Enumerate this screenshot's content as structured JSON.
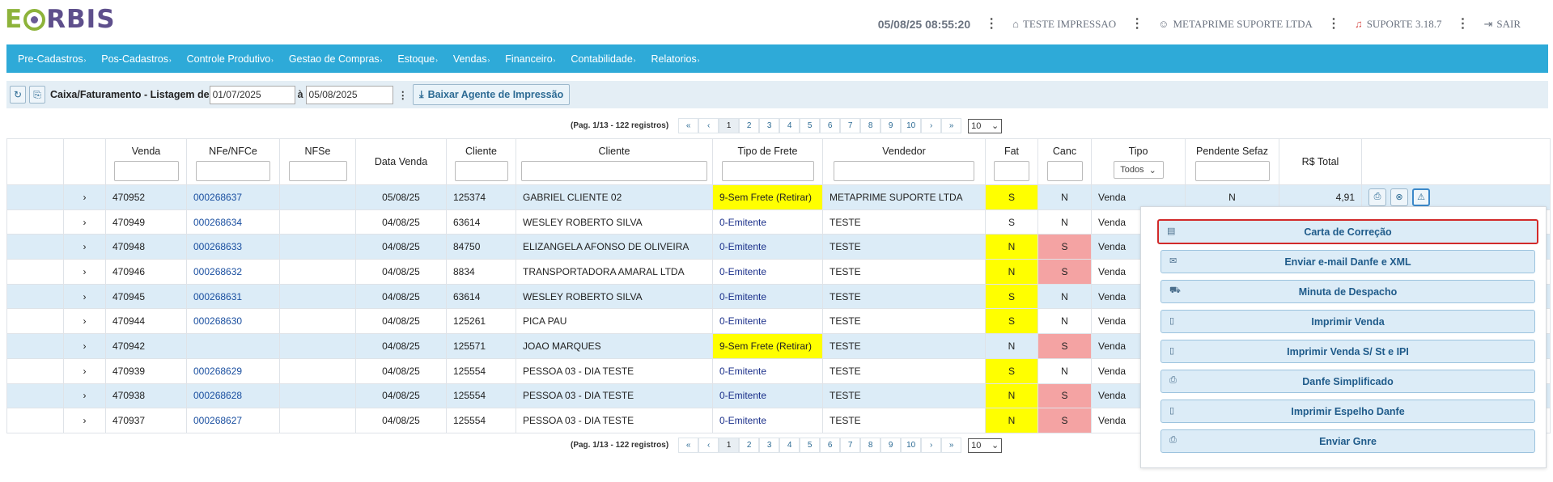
{
  "brand": {
    "logo_e": "E",
    "logo_rest": "RBIS"
  },
  "header": {
    "datetime": "05/08/25 08:55:20",
    "printer_label": "TESTE IMPRESSAO",
    "company_label": "METAPRIME SUPORTE LTDA",
    "support_label": "SUPORTE 3.18.7",
    "logout_label": "SAIR"
  },
  "menu": [
    {
      "label": "Pre-Cadastros"
    },
    {
      "label": "Pos-Cadastros"
    },
    {
      "label": "Controle Produtivo"
    },
    {
      "label": "Gestao de Compras"
    },
    {
      "label": "Estoque"
    },
    {
      "label": "Vendas"
    },
    {
      "label": "Financeiro"
    },
    {
      "label": "Contabilidade"
    },
    {
      "label": "Relatorios"
    }
  ],
  "toolbar": {
    "title": "Caixa/Faturamento - Listagem de",
    "date_from": "01/07/2025",
    "date_sep": "à",
    "date_to": "05/08/2025",
    "download_label": "Baixar Agente de Impressão"
  },
  "pager": {
    "info": "(Pag. 1/13 - 122 registros)",
    "first": "«",
    "prev": "‹",
    "pages": [
      "1",
      "2",
      "3",
      "4",
      "5",
      "6",
      "7",
      "8",
      "9",
      "10"
    ],
    "next": "›",
    "last": "»",
    "page_size": "10"
  },
  "columns": [
    "",
    "",
    "Venda",
    "NFe/NFCe",
    "NFSe",
    "Data Venda",
    "Cliente",
    "Cliente",
    "Tipo de Frete",
    "Vendedor",
    "Fat",
    "Canc",
    "Tipo",
    "Pendente Sefaz",
    "R$ Total",
    ""
  ],
  "tipo_filter": "Todos",
  "rows": [
    {
      "expand": "›",
      "venda": "470952",
      "nfe": "000268637",
      "nfse": "",
      "data": "05/08/25",
      "cliente_id": "125374",
      "cliente": "GABRIEL CLIENTE 02",
      "frete": "9-Sem Frete (Retirar)",
      "vendedor": "METAPRIME SUPORTE LTDA",
      "fat": "S",
      "canc": "N",
      "tipo": "Venda",
      "pendente": "N",
      "total": "4,91"
    },
    {
      "expand": "›",
      "venda": "470949",
      "nfe": "000268634",
      "nfse": "",
      "data": "04/08/25",
      "cliente_id": "63614",
      "cliente": "WESLEY ROBERTO SILVA",
      "frete": "0-Emitente",
      "vendedor": "TESTE",
      "fat": "S",
      "canc": "N",
      "tipo": "Venda",
      "pendente": "",
      "total": ""
    },
    {
      "expand": "›",
      "venda": "470948",
      "nfe": "000268633",
      "nfse": "",
      "data": "04/08/25",
      "cliente_id": "84750",
      "cliente": "ELIZANGELA AFONSO DE OLIVEIRA",
      "frete": "0-Emitente",
      "vendedor": "TESTE",
      "fat": "N",
      "canc": "S",
      "tipo": "Venda",
      "pendente": "",
      "total": ""
    },
    {
      "expand": "›",
      "venda": "470946",
      "nfe": "000268632",
      "nfse": "",
      "data": "04/08/25",
      "cliente_id": "8834",
      "cliente": "TRANSPORTADORA AMARAL LTDA",
      "frete": "0-Emitente",
      "vendedor": "TESTE",
      "fat": "N",
      "canc": "S",
      "tipo": "Venda",
      "pendente": "",
      "total": ""
    },
    {
      "expand": "›",
      "venda": "470945",
      "nfe": "000268631",
      "nfse": "",
      "data": "04/08/25",
      "cliente_id": "63614",
      "cliente": "WESLEY ROBERTO SILVA",
      "frete": "0-Emitente",
      "vendedor": "TESTE",
      "fat": "S",
      "canc": "N",
      "tipo": "Venda",
      "pendente": "",
      "total": ""
    },
    {
      "expand": "›",
      "venda": "470944",
      "nfe": "000268630",
      "nfse": "",
      "data": "04/08/25",
      "cliente_id": "125261",
      "cliente": "PICA PAU",
      "frete": "0-Emitente",
      "vendedor": "TESTE",
      "fat": "S",
      "canc": "N",
      "tipo": "Venda",
      "pendente": "",
      "total": ""
    },
    {
      "expand": "›",
      "venda": "470942",
      "nfe": "",
      "nfse": "",
      "data": "04/08/25",
      "cliente_id": "125571",
      "cliente": "JOAO MARQUES",
      "frete": "9-Sem Frete (Retirar)",
      "vendedor": "TESTE",
      "fat": "N",
      "canc": "S",
      "tipo": "Venda",
      "pendente": "",
      "total": ""
    },
    {
      "expand": "›",
      "venda": "470939",
      "nfe": "000268629",
      "nfse": "",
      "data": "04/08/25",
      "cliente_id": "125554",
      "cliente": "PESSOA 03 - DIA TESTE",
      "frete": "0-Emitente",
      "vendedor": "TESTE",
      "fat": "S",
      "canc": "N",
      "tipo": "Venda",
      "pendente": "",
      "total": ""
    },
    {
      "expand": "›",
      "venda": "470938",
      "nfe": "000268628",
      "nfse": "",
      "data": "04/08/25",
      "cliente_id": "125554",
      "cliente": "PESSOA 03 - DIA TESTE",
      "frete": "0-Emitente",
      "vendedor": "TESTE",
      "fat": "N",
      "canc": "S",
      "tipo": "Venda",
      "pendente": "",
      "total": ""
    },
    {
      "expand": "›",
      "venda": "470937",
      "nfe": "000268627",
      "nfse": "",
      "data": "04/08/25",
      "cliente_id": "125554",
      "cliente": "PESSOA 03 - DIA TESTE",
      "frete": "0-Emitente",
      "vendedor": "TESTE",
      "fat": "N",
      "canc": "S",
      "tipo": "Venda",
      "pendente": "",
      "total": ""
    }
  ],
  "dropdown": [
    {
      "label": "Carta de Correção",
      "icon": "document-icon"
    },
    {
      "label": "Enviar e-mail Danfe e XML",
      "icon": "envelope-icon"
    },
    {
      "label": "Minuta de Despacho",
      "icon": "truck-icon"
    },
    {
      "label": "Imprimir Venda",
      "icon": "file-icon"
    },
    {
      "label": "Imprimir Venda S/ St e IPI",
      "icon": "file-icon"
    },
    {
      "label": "Danfe Simplificado",
      "icon": "printer-icon"
    },
    {
      "label": "Imprimir Espelho Danfe",
      "icon": "file-icon"
    },
    {
      "label": "Enviar Gnre",
      "icon": "printer-icon"
    }
  ],
  "colors": {
    "menu_bg": "#2eaad8",
    "row_alt": "#dcecf7",
    "yellow": "#ffff00",
    "pink": "#f4a3a3",
    "link": "#1a4fa0",
    "highlight_border": "#d22a2a"
  }
}
